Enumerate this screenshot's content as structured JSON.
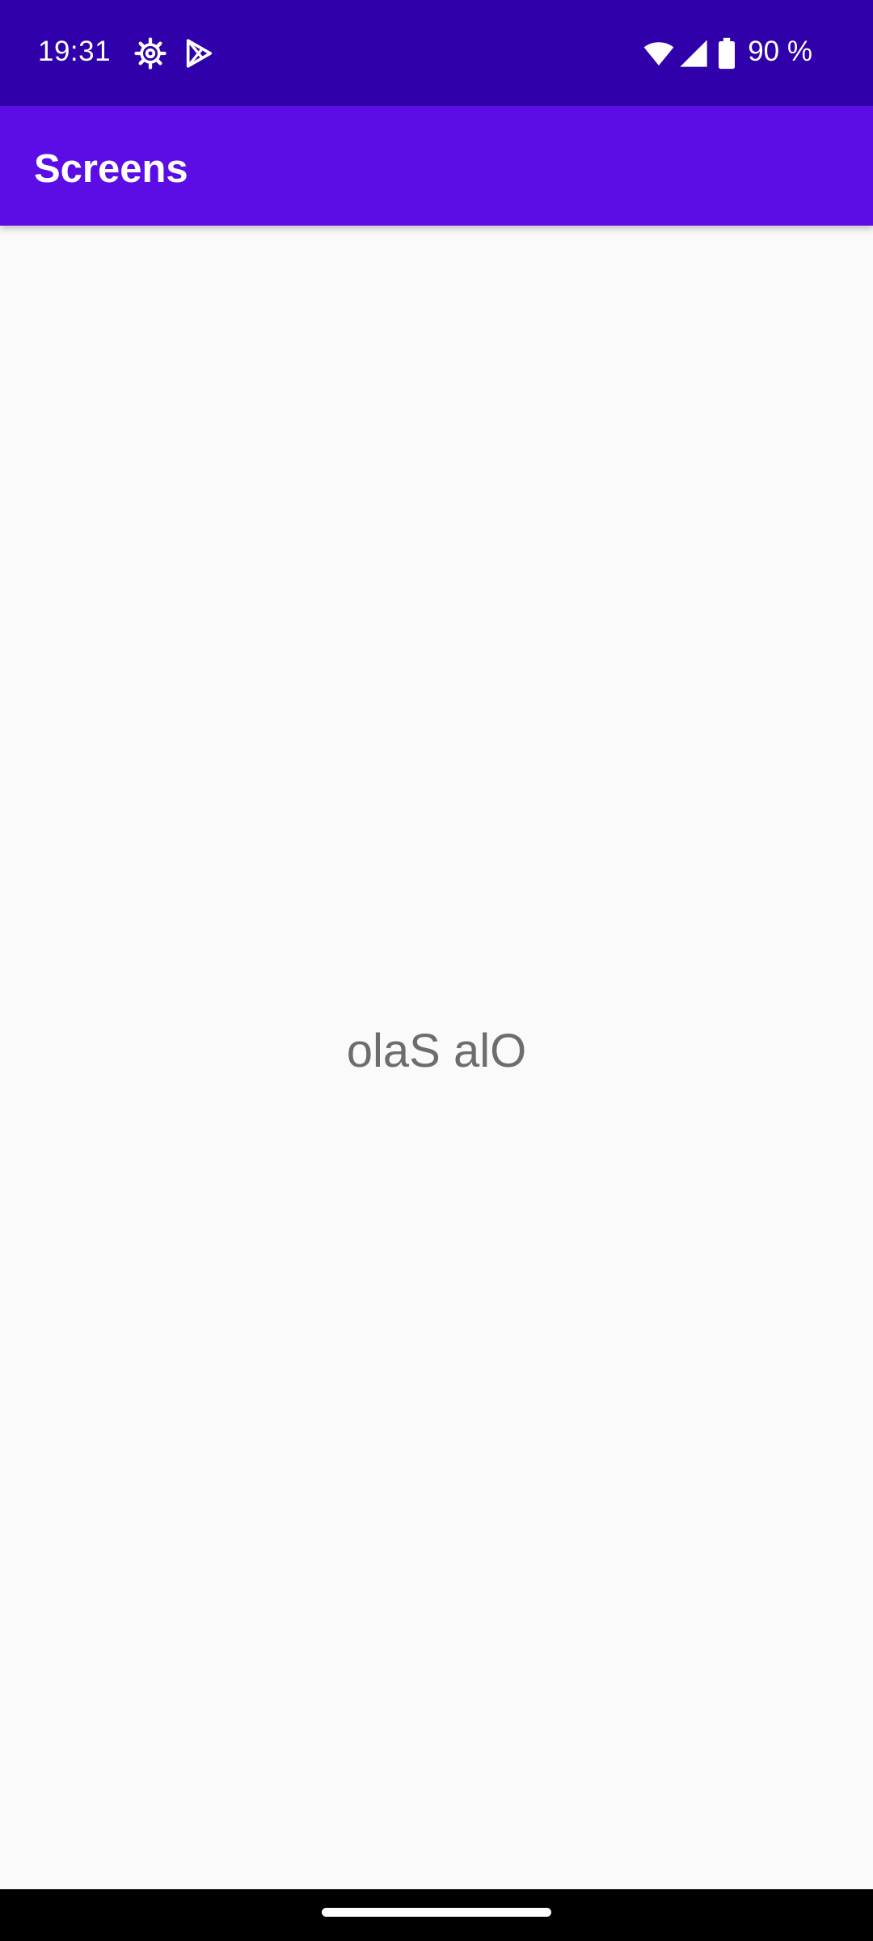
{
  "status_bar": {
    "time": "19:31",
    "battery_percent": "90 %",
    "icons": [
      "settings-gear-icon",
      "play-store-icon",
      "wifi-icon",
      "cell-signal-icon",
      "battery-icon"
    ],
    "background": "#3000aa"
  },
  "app_bar": {
    "title": "Screens",
    "background": "#5c0de6"
  },
  "main": {
    "center_text": "olaS alO"
  },
  "colors": {
    "content_background": "#fafafa",
    "center_text": "#6d6d6d",
    "navigation_bar": "#000000"
  }
}
